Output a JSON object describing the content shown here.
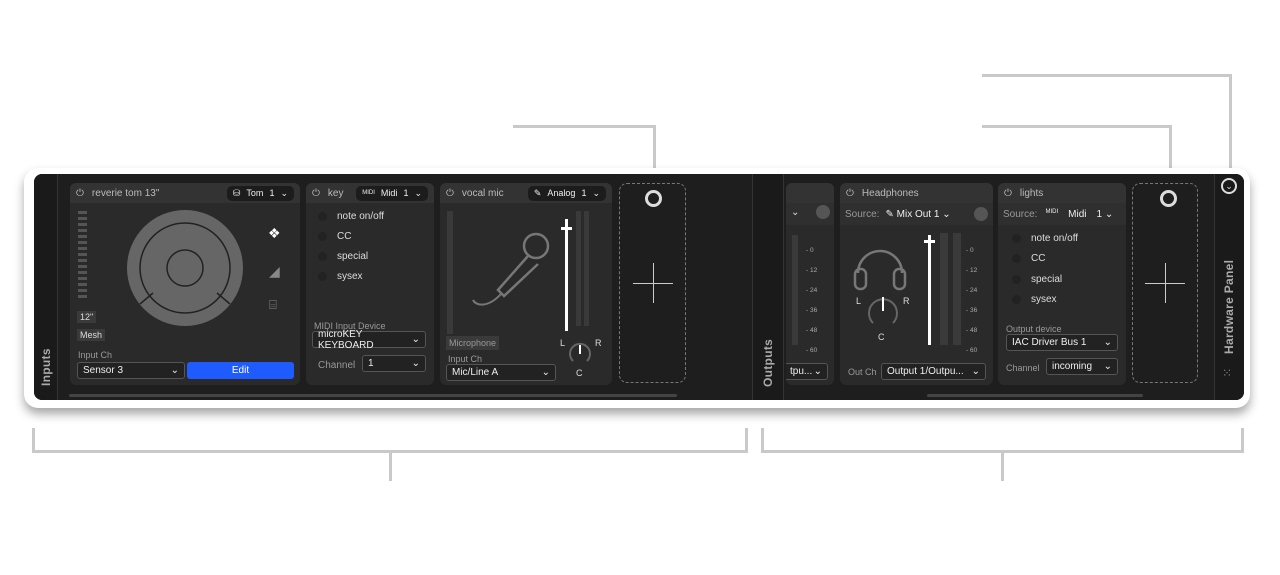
{
  "sections": {
    "inputs_label": "Inputs",
    "outputs_label": "Outputs",
    "hardware_label": "Hardware Panel"
  },
  "drum": {
    "name": "reverie tom 13\"",
    "type": "Tom",
    "channel": "1",
    "size": "12\"",
    "head": "Mesh",
    "input_ch_label": "Input Ch",
    "input_ch": "Sensor 3",
    "edit": "Edit"
  },
  "key": {
    "name": "key",
    "type": "Midi",
    "channel": "1",
    "items": [
      "note on/off",
      "CC",
      "special",
      "sysex"
    ],
    "device_label": "MIDI Input Device",
    "device": "microKEY KEYBOARD",
    "channel_label": "Channel",
    "channel_value": "1"
  },
  "mic": {
    "name": "vocal mic",
    "type": "Analog",
    "channel": "1",
    "mic_tag": "Microphone",
    "input_ch_label": "Input Ch",
    "input_ch": "Mic/Line A",
    "pan_l": "L",
    "pan_r": "R",
    "pan_c": "C"
  },
  "out_partial": {
    "out_ch": "tpu..."
  },
  "headphones": {
    "name": "Headphones",
    "source_label": "Source:",
    "source": "Mix Out 1",
    "scale": [
      "0",
      "12",
      "24",
      "36",
      "48",
      "60"
    ],
    "pan_l": "L",
    "pan_r": "R",
    "pan_c": "C",
    "out_ch_label": "Out Ch",
    "out_ch": "Output 1/Outpu..."
  },
  "lights": {
    "name": "lights",
    "source_label": "Source:",
    "source": "Midi",
    "channel": "1",
    "items": [
      "note on/off",
      "CC",
      "special",
      "sysex"
    ],
    "device_label": "Output device",
    "device": "IAC Driver Bus 1",
    "channel_label": "Channel",
    "channel_value": "incoming"
  }
}
